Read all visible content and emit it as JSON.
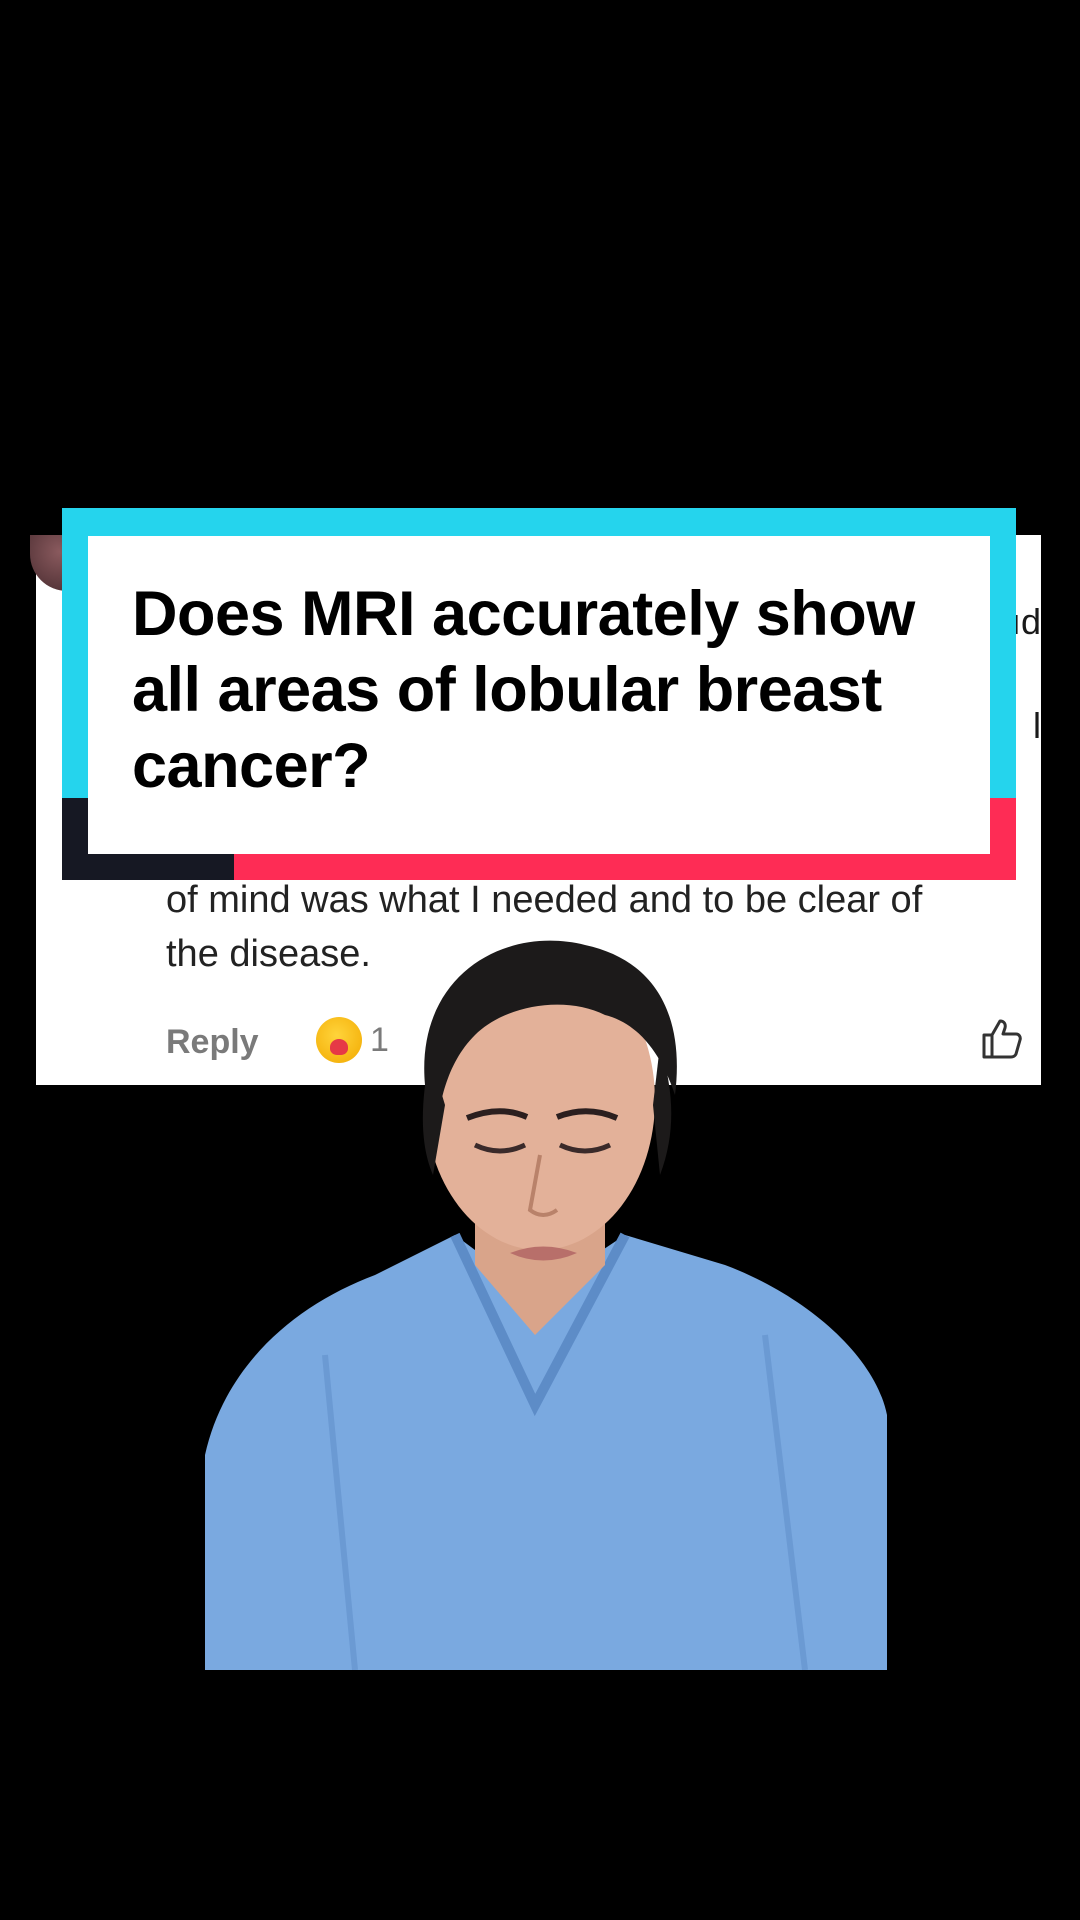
{
  "title_overlay": {
    "text": "Does MRI accurately show all areas of lobular breast cancer?"
  },
  "comment": {
    "edge_fragments": [
      "ıd",
      "l"
    ],
    "text_lines": [
      "of mind was what I needed and to be clear of",
      "the disease."
    ],
    "reply_label": "Reply",
    "reaction_icon": "hug-emoji",
    "reaction_count": "1",
    "like_icon": "thumbs-up-outline-icon"
  },
  "colors": {
    "accent_cyan": "#25d4ed",
    "accent_red": "#fe2c55",
    "scrub_blue": "#7aa9e0"
  }
}
